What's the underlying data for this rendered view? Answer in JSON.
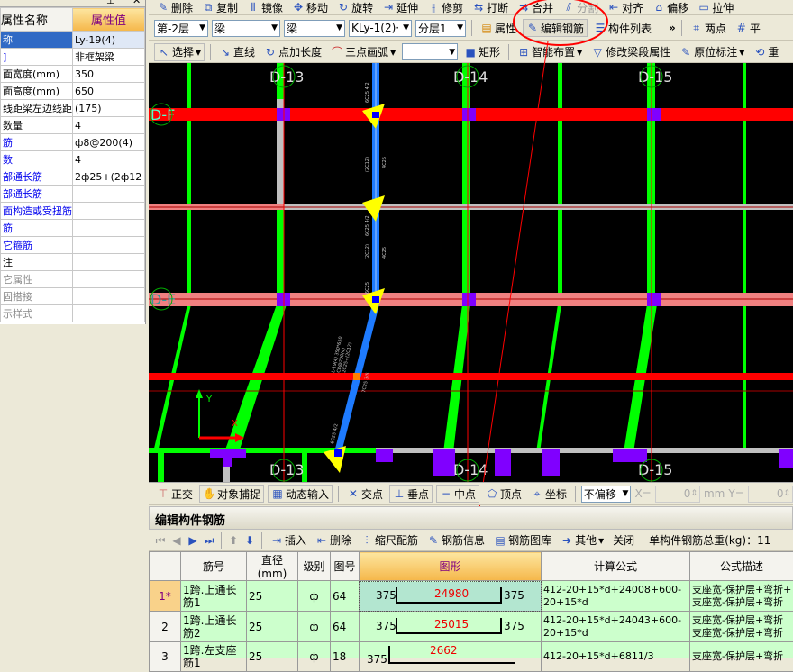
{
  "property_panel": {
    "pin_icon": "pin-icon",
    "close_icon": "close-icon",
    "header_name": "属性名称",
    "header_value": "属性值",
    "rows": [
      {
        "name": "称",
        "value": "Ly-19(4)",
        "style": "selected"
      },
      {
        "name": "]",
        "value": "非框架梁",
        "style": "blue"
      },
      {
        "name": "面宽度(mm)",
        "value": "350",
        "style": ""
      },
      {
        "name": "面高度(mm)",
        "value": "650",
        "style": ""
      },
      {
        "name": "线距梁左边线距",
        "value": "(175)",
        "style": ""
      },
      {
        "name": "数量",
        "value": "4",
        "style": ""
      },
      {
        "name": "筋",
        "value": "ф8@200(4)",
        "style": "blue"
      },
      {
        "name": "数",
        "value": "4",
        "style": "blue"
      },
      {
        "name": "部通长筋",
        "value": "2ф25+(2ф12",
        "style": "blue"
      },
      {
        "name": "部通长筋",
        "value": "",
        "style": "blue"
      },
      {
        "name": "面构造或受扭筋",
        "value": "",
        "style": "blue"
      },
      {
        "name": "筋",
        "value": "",
        "style": "blue"
      },
      {
        "name": "它箍筋",
        "value": "",
        "style": "blue"
      },
      {
        "name": "注",
        "value": "",
        "style": ""
      },
      {
        "name": "它属性",
        "value": "",
        "style": "gray"
      },
      {
        "name": "固搭接",
        "value": "",
        "style": "gray"
      },
      {
        "name": "示样式",
        "value": "",
        "style": "gray"
      }
    ]
  },
  "toolbar1": [
    "删除",
    "复制",
    "镜像",
    "移动",
    "旋转",
    "延伸",
    "修剪",
    "打断",
    "合并",
    "分割",
    "对齐",
    "偏移",
    "拉伸"
  ],
  "toolbar2": {
    "floor": "第-2层",
    "category": "梁",
    "type": "梁",
    "component": "KLy-1(2)·",
    "layer": "分层1",
    "attr": "属性",
    "edit_rebar": "编辑钢筋",
    "component_list": "构件列表",
    "more": "»",
    "two_point": "两点",
    "parallel": "平"
  },
  "toolbar3": {
    "select": "选择",
    "line": "直线",
    "point_len": "点加长度",
    "arc": "三点画弧",
    "rect": "矩形",
    "smart": "智能布置",
    "modify_span": "修改梁段属性",
    "in_situ": "原位标注",
    "redo": "重"
  },
  "canvas": {
    "axes_top": [
      "D-13",
      "D-14",
      "D-15"
    ],
    "axes_bottom": [
      "D-13",
      "D-14",
      "D-15"
    ],
    "axes_left": [
      "D-F",
      "D-E"
    ],
    "beam_labels": [
      "6C25 4/2",
      "(2C12)",
      "4C25",
      "6C25 4/2",
      "(2C12)",
      "4C25",
      "6C25",
      "L-19(4) 350*650",
      "C8@200(4)",
      "2C25+(2C12)",
      "7C25 3/5",
      "6C25 4/2"
    ],
    "ucs_x": "X",
    "ucs_y": "Y"
  },
  "snapbar": {
    "ortho": "正交",
    "snap": "对象捕捉",
    "dynamic": "动态输入",
    "intersection": "交点",
    "perpendicular": "垂点",
    "midpoint": "中点",
    "vertex": "顶点",
    "coord": "坐标",
    "offset": "不偏移",
    "x_label": "X=",
    "x_value": "0",
    "unit": "mm",
    "y_label": "Y=",
    "y_value": "0"
  },
  "rebar_panel": {
    "title": "编辑构件钢筋",
    "toolbar": {
      "insert": "插入",
      "delete": "删除",
      "scale": "缩尺配筋",
      "info": "钢筋信息",
      "library": "钢筋图库",
      "other": "其他",
      "close": "关闭",
      "total_weight": "单构件钢筋总重(kg)：11"
    },
    "columns": [
      "",
      "筋号",
      "直径(mm)",
      "级别",
      "图号",
      "图形",
      "计算公式",
      "公式描述"
    ],
    "rows": [
      {
        "num": "1*",
        "name": "1跨.上通长筋1",
        "dia": "25",
        "grade": "ф",
        "fig": "64",
        "left": "375",
        "len": "24980",
        "right": "375",
        "formula": "412-20+15*d+24008+600-20+15*d",
        "desc": "支座宽-保护层+弯折+\n支座宽-保护层+弯折"
      },
      {
        "num": "2",
        "name": "1跨.上通长筋2",
        "dia": "25",
        "grade": "ф",
        "fig": "64",
        "left": "375",
        "len": "25015",
        "right": "375",
        "formula": "412-20+15*d+24043+600-20+15*d",
        "desc": "支座宽-保护层+弯折\n支座宽-保护层+弯折"
      },
      {
        "num": "3",
        "name": "1跨.左支座筋1",
        "dia": "25",
        "grade": "ф",
        "fig": "18",
        "left": "375",
        "len": "2662",
        "right": "",
        "formula": "412-20+15*d+6811/3",
        "desc": "支座宽-保护层+弯折"
      }
    ]
  },
  "colors": {
    "annotation": "#ff0000",
    "selected_beam": "#1e7bff",
    "wall": "#00ff00",
    "beam_red": "#ff0000",
    "beam_pink": "#f08080",
    "column": "#8000ff"
  }
}
